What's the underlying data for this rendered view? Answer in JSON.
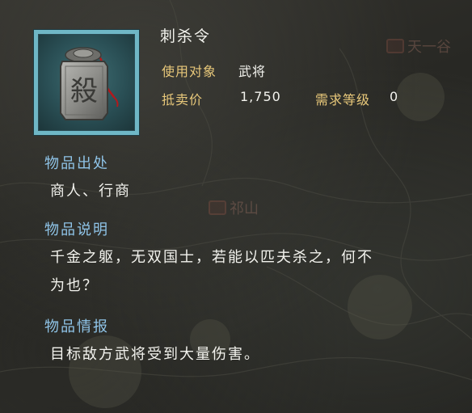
{
  "item": {
    "name": "刺杀令",
    "icon": "killing-seal-token-icon",
    "icon_glyph": "殺"
  },
  "stats": {
    "target_label": "使用对象",
    "target_value": "武将",
    "sell_label": "抵卖价",
    "sell_value": "1,750",
    "level_label": "需求等级",
    "level_value": "0"
  },
  "sections": {
    "source": {
      "heading": "物品出处",
      "text": "商人、行商"
    },
    "description": {
      "heading": "物品说明",
      "line1": "千金之躯，无双国士，若能以匹夫杀之，何不",
      "line2": "为也？"
    },
    "info": {
      "heading": "物品情报",
      "text": "目标敌方武将受到大量伤害。"
    }
  },
  "background_map": {
    "labels": [
      "天一谷",
      "祁山"
    ]
  },
  "colors": {
    "frame_border": "#6fb7c6",
    "section_heading": "#8fc4e8",
    "stat_label": "#e8c87a",
    "body_text": "#f3f3ee"
  }
}
